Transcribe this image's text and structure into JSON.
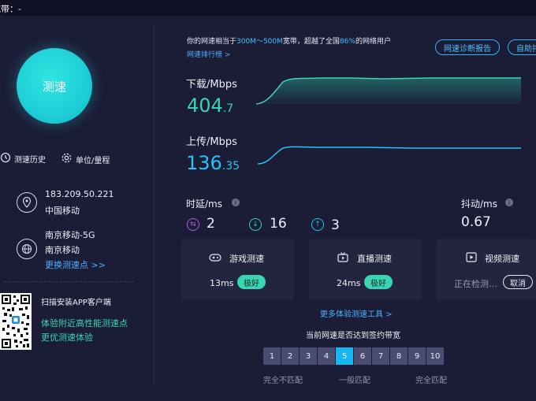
{
  "topbar": {
    "bandwidth_text": "宽带：-"
  },
  "left": {
    "gauge_label": "测速",
    "history_label": "测速历史",
    "unit_label": "单位/量程",
    "ip": "183.209.50.221",
    "isp": "中国移动",
    "node_name": "南京移动-5G",
    "node_isp": "南京移动",
    "change_node": "更换测速点 >>",
    "qr_title": "扫描安装APP客户端",
    "qr_line1": "体验附近高性能测速点",
    "qr_line2": "更优测速体验"
  },
  "summary": {
    "prefix": "你的网速相当于",
    "range": "300M～500M",
    "mid": "宽带，超越了全国",
    "percent": "86%",
    "suffix": "的网络用户",
    "rank_link": "网速排行榜 >"
  },
  "buttons": {
    "report": "网速诊断报告",
    "auto": "自助排"
  },
  "download": {
    "label": "下载/Mbps",
    "value_int": "404",
    "value_dec": ".7"
  },
  "upload": {
    "label": "上传/Mbps",
    "value_int": "136",
    "value_dec": ".35"
  },
  "latency": {
    "label": "时延/ms",
    "v1": "2",
    "v2": "16",
    "v3": "3"
  },
  "jitter": {
    "label": "抖动/ms",
    "value": "0.67"
  },
  "cards": {
    "game": {
      "title": "游戏测速",
      "value": "13ms",
      "badge": "极好"
    },
    "live": {
      "title": "直播测速",
      "value": "24ms",
      "badge": "极好"
    },
    "video": {
      "title": "视频测速",
      "status": "正在检测…",
      "cancel": "取消"
    }
  },
  "more_tools": "更多体验测速工具 >",
  "contract": {
    "title": "当前网速是否达到签约带宽",
    "scale": [
      "1",
      "2",
      "3",
      "4",
      "5",
      "6",
      "7",
      "8",
      "9",
      "10"
    ],
    "active_value": 5,
    "low": "完全不匹配",
    "mid": "一般匹配",
    "high": "完全匹配"
  },
  "colors": {
    "accent_teal": "#3ad6b4",
    "accent_blue": "#16b6f3",
    "bg": "#1b1c36"
  }
}
